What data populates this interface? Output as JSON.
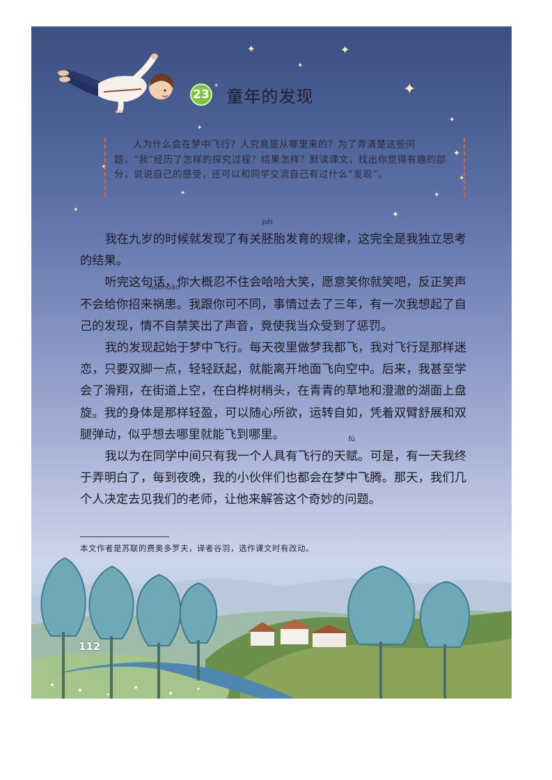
{
  "lesson": {
    "number": "23",
    "mark": "*",
    "title": "童年的发现"
  },
  "intro": "人为什么会在梦中飞行？人究竟是从哪里来的？为了弄清楚这些问题，“我”经历了怎样的探究过程？结果怎样？默读课文，找出你觉得有趣的部分，说说自己的感受，还可以和同学交流自己有过什么“发现”。",
  "body": {
    "p1": {
      "before": "我在九岁的时候就发现了有关",
      "ruby_char": "胚",
      "ruby_pinyin": "pēi",
      "after": "胎发育的规律，这完全是我独立思考的结果。"
    },
    "p2": {
      "before": "听完这句话，你大概忍不住会哈哈大笑，愿意笑你就笑吧，反正笑声不会给你招来",
      "ruby_char": "祸患",
      "ruby_pinyin": "huòhuàn",
      "after": "。我跟你可不同，事情过去了三年，有一次我想起了自己的发现，情不自禁笑出了声音，竟使我当众受到了惩罚。"
    },
    "p3": "我的发现起始于梦中飞行。每天夜里做梦我都飞，我对飞行是那样迷恋，只要双脚一点，轻轻跃起，就能离开地面飞向空中。后来，我甚至学会了滑翔，在街道上空，在白桦树梢头，在青青的草地和澄澈的湖面上盘旋。我的身体是那样轻盈，可以随心所欲，运转自如，凭着双臂舒展和双腿弹动，似乎想去哪里就能飞到哪里。",
    "p4": {
      "before": "我以为在同学中间只有我一个人具有飞行的天",
      "ruby_char": "赋",
      "ruby_pinyin": "fù",
      "after": "。可是，有一天我终于弄明白了，每到夜晚，我的小伙伴们也都会在梦中飞腾。那天，我们几个人决定去见我们的老师，让他来解答这个奇妙的问题。"
    }
  },
  "footnote": "本文作者是苏联的费奥多罗夫，译者谷羽，选作课文时有改动。",
  "page_number": "112",
  "colors": {
    "sky_top": "#3d4f80",
    "sky_bottom": "#cdd6ea",
    "badge": "#7fc24a",
    "intro_border": "#e0662c",
    "tree": "#5b9fb4"
  }
}
